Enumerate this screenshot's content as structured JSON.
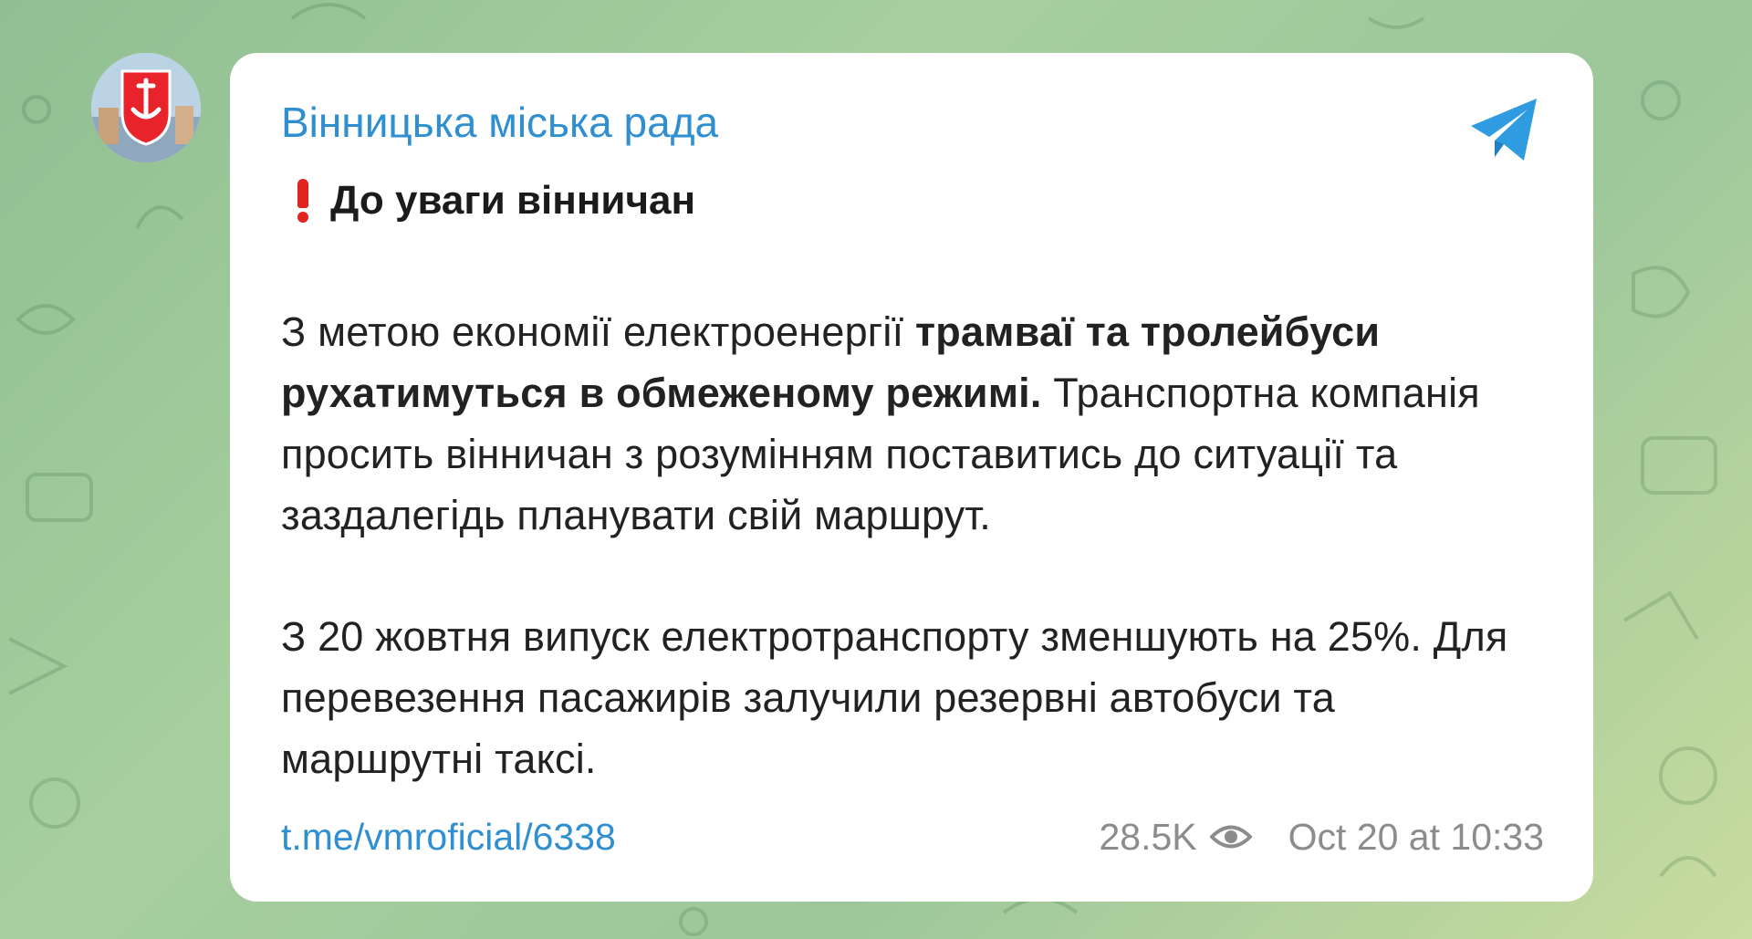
{
  "channel": {
    "name": "Вінницька міська рада",
    "avatar_icon": "city-coat-of-arms-icon",
    "brand_icon": "telegram-icon"
  },
  "post": {
    "heading": "До уваги вінничан",
    "heading_icon": "red-exclamation-icon",
    "para1_before": "З метою економії електроенергії ",
    "para1_bold": "трамваї та тролейбуси рухатимуться в обмеженому режимі.",
    "para1_after": " Транспортна компанія просить вінничан з розумінням поставитись до ситуації та заздалегідь планувати свій маршрут.",
    "para2": "З 20 жовтня випуск електротранспорту зменшують на 25%. Для перевезення пасажирів залучили резервні автобуси та маршрутні таксі."
  },
  "footer": {
    "link": "t.me/vmroficial/6338",
    "views": "28.5K",
    "views_icon": "eye-icon",
    "date": "Oct 20 at 10:33"
  },
  "colors": {
    "link": "#2f8fd0",
    "accent_red": "#e2231f",
    "meta_gray": "#8c8c8c"
  }
}
